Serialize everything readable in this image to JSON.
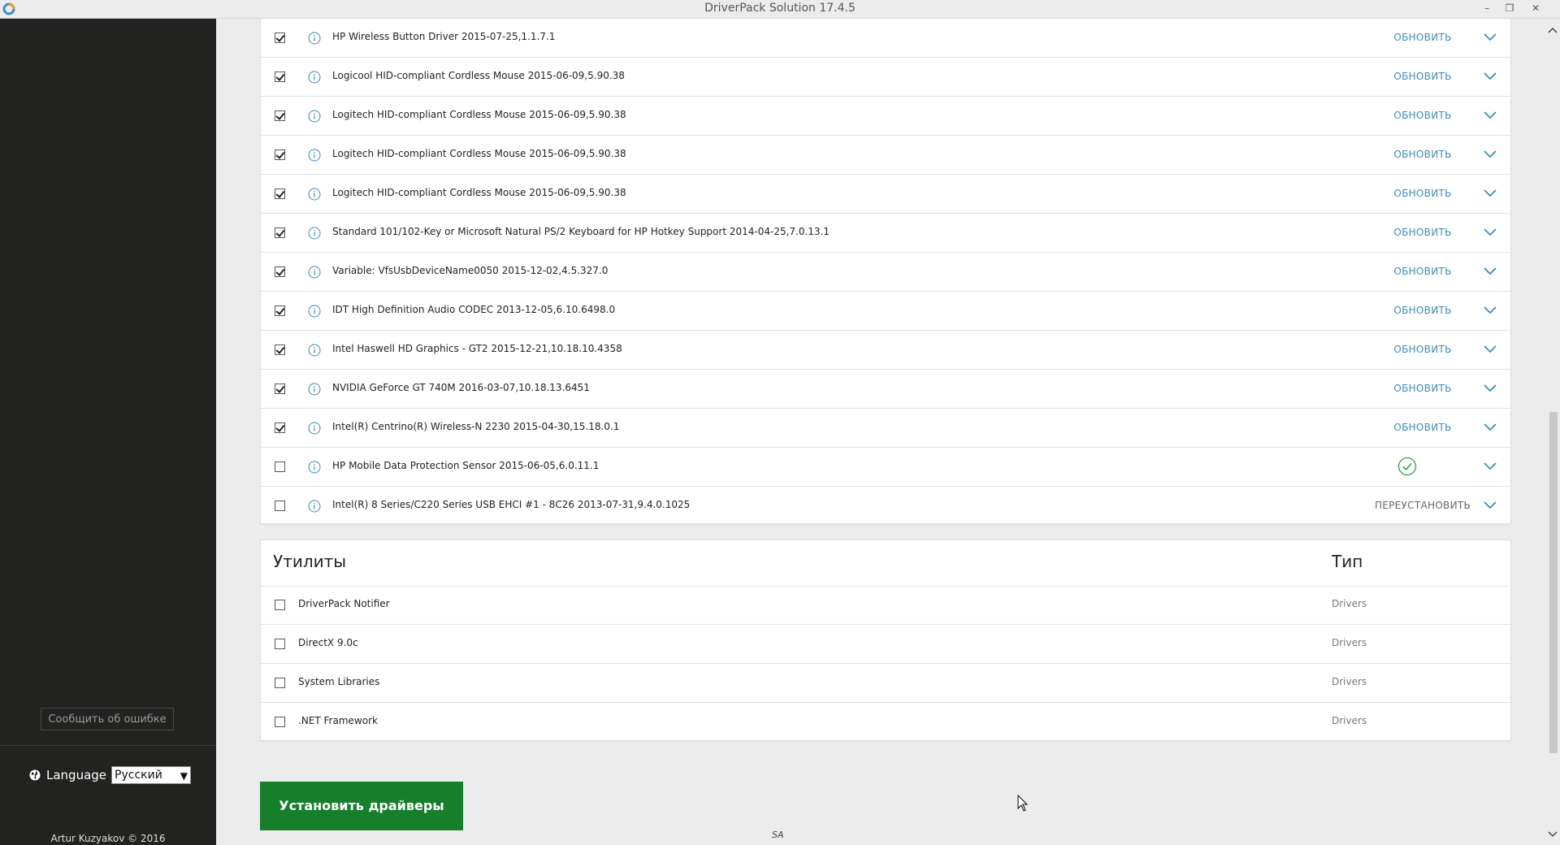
{
  "window": {
    "title": "DriverPack Solution 17.4.5",
    "controls": {
      "minimize": "–",
      "maximize": "❐",
      "close": "✕"
    }
  },
  "sidebar": {
    "report_label": "Сообщить об ошибке",
    "language_label": "Language",
    "language_value": "Русский",
    "copyright": "Artur Kuzyakov © 2016"
  },
  "drivers": {
    "rows": [
      {
        "name": "HP Wireless Button Driver 2015-07-25,1.1.7.1",
        "checked": true,
        "action": "ОБНОВИТЬ"
      },
      {
        "name": "Logicool HID-compliant Cordless Mouse 2015-06-09,5.90.38",
        "checked": true,
        "action": "ОБНОВИТЬ"
      },
      {
        "name": "Logitech HID-compliant Cordless Mouse 2015-06-09,5.90.38",
        "checked": true,
        "action": "ОБНОВИТЬ"
      },
      {
        "name": "Logitech HID-compliant Cordless Mouse 2015-06-09,5.90.38",
        "checked": true,
        "action": "ОБНОВИТЬ"
      },
      {
        "name": "Logitech HID-compliant Cordless Mouse 2015-06-09,5.90.38",
        "checked": true,
        "action": "ОБНОВИТЬ"
      },
      {
        "name": "Standard 101/102-Key or Microsoft Natural PS/2 Keyboard for HP Hotkey Support 2014-04-25,7.0.13.1",
        "checked": true,
        "action": "ОБНОВИТЬ"
      },
      {
        "name": "Variable: VfsUsbDeviceName0050 2015-12-02,4.5.327.0",
        "checked": true,
        "action": "ОБНОВИТЬ"
      },
      {
        "name": "IDT High Definition Audio CODEC 2013-12-05,6.10.6498.0",
        "checked": true,
        "action": "ОБНОВИТЬ"
      },
      {
        "name": "Intel Haswell HD Graphics - GT2 2015-12-21,10.18.10.4358",
        "checked": true,
        "action": "ОБНОВИТЬ"
      },
      {
        "name": "NVIDIA GeForce GT 740M 2016-03-07,10.18.13.6451",
        "checked": true,
        "action": "ОБНОВИТЬ"
      },
      {
        "name": "Intel(R) Centrino(R) Wireless-N 2230 2015-04-30,15.18.0.1",
        "checked": true,
        "action": "ОБНОВИТЬ"
      },
      {
        "name": "HP Mobile Data Protection Sensor 2015-06-05,6.0.11.1",
        "checked": false,
        "action": ""
      },
      {
        "name": "Intel(R) 8 Series/C220 Series USB EHCI #1 - 8C26 2013-07-31,9.4.0.1025",
        "checked": false,
        "action": "ПЕРЕУСТАНОВИТЬ"
      }
    ]
  },
  "utilities": {
    "title": "Утилиты",
    "type_header": "Тип",
    "rows": [
      {
        "name": "DriverPack Notifier",
        "type": "Drivers",
        "checked": false
      },
      {
        "name": "DirectX 9.0c",
        "type": "Drivers",
        "checked": false
      },
      {
        "name": "System Libraries",
        "type": "Drivers",
        "checked": false
      },
      {
        "name": ".NET Framework",
        "type": "Drivers",
        "checked": false
      }
    ]
  },
  "install_button": "Установить драйверы",
  "footer_logo": "SA",
  "colors": {
    "accent_blue": "#3a8db5",
    "install_green": "#157f2c",
    "ok_green": "#2e9b45",
    "sidebar_bg": "#222221"
  }
}
